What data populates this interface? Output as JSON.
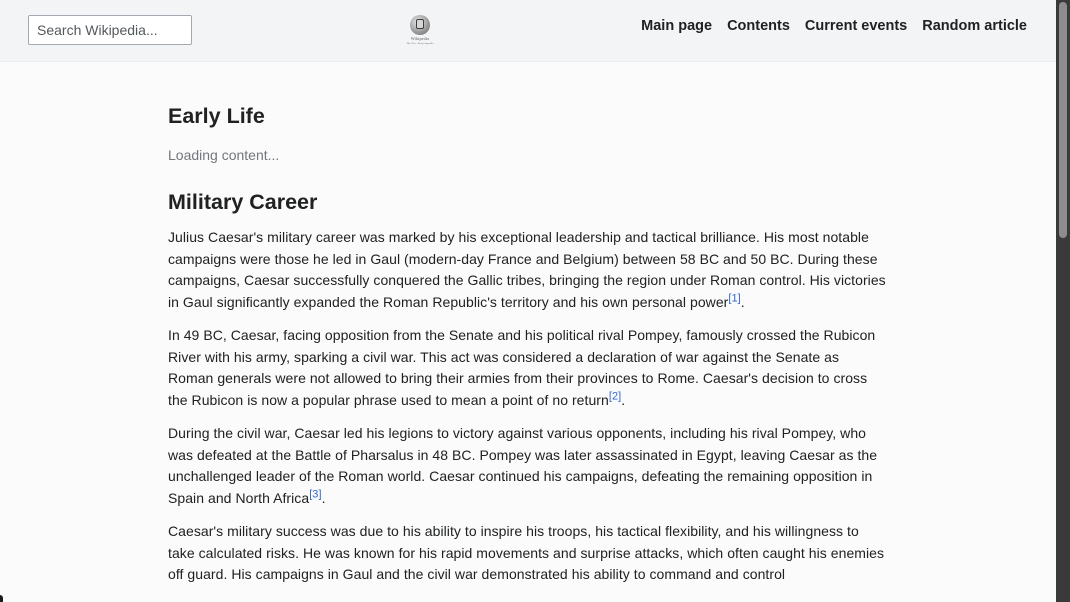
{
  "header": {
    "search": {
      "placeholder": "Search Wikipedia...",
      "value": ""
    },
    "logo": {
      "wordmark": "Wikipedia",
      "tagline": "The Free Encyclopedia"
    },
    "nav": [
      {
        "label": "Main page"
      },
      {
        "label": "Contents"
      },
      {
        "label": "Current events"
      },
      {
        "label": "Random article"
      }
    ]
  },
  "article": {
    "sections": [
      {
        "heading": "Early Life",
        "status": "Loading content..."
      },
      {
        "heading": "Military Career",
        "paragraphs": [
          {
            "text": "Julius Caesar's military career was marked by his exceptional leadership and tactical brilliance. His most notable campaigns were those he led in Gaul (modern-day France and Belgium) between 58 BC and 50 BC. During these campaigns, Caesar successfully conquered the Gallic tribes, bringing the region under Roman control. His victories in Gaul significantly expanded the Roman Republic's territory and his own personal power",
            "ref": "[1]",
            "end": "."
          },
          {
            "text": "In 49 BC, Caesar, facing opposition from the Senate and his political rival Pompey, famously crossed the Rubicon River with his army, sparking a civil war. This act was considered a declaration of war against the Senate as Roman generals were not allowed to bring their armies from their provinces to Rome. Caesar's decision to cross the Rubicon is now a popular phrase used to mean a point of no return",
            "ref": "[2]",
            "end": "."
          },
          {
            "text": "During the civil war, Caesar led his legions to victory against various opponents, including his rival Pompey, who was defeated at the Battle of Pharsalus in 48 BC. Pompey was later assassinated in Egypt, leaving Caesar as the unchallenged leader of the Roman world. Caesar continued his campaigns, defeating the remaining opposition in Spain and North Africa",
            "ref": "[3]",
            "end": "."
          },
          {
            "text": "Caesar's military success was due to his ability to inspire his troops, his tactical flexibility, and his willingness to take calculated risks. He was known for his rapid movements and surprise attacks, which often caught his enemies off guard. His campaigns in Gaul and the civil war demonstrated his ability to command and control",
            "ref": "",
            "end": ""
          }
        ]
      }
    ]
  },
  "colors": {
    "header_bg": "#f3f4f5",
    "page_bg": "#fbfbfb",
    "text": "#202122",
    "link": "#3366cc",
    "muted": "#72777d"
  }
}
